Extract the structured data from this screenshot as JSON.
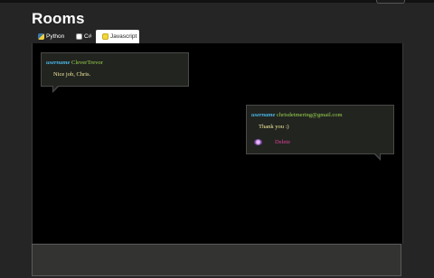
{
  "page": {
    "title": "Rooms"
  },
  "tabs": [
    {
      "label": "Python",
      "icon": "python-icon"
    },
    {
      "label": "C#",
      "icon": "csharp-icon"
    },
    {
      "label": "Javascript",
      "icon": "javascript-icon",
      "active": true
    }
  ],
  "messages": [
    {
      "username_label": "username",
      "username": "CleverTrevor",
      "text": "Nice job, Chris."
    },
    {
      "username_label": "username",
      "username": "chrisdetmering@gmail.com",
      "text": "Thank you :)",
      "edit_label": "",
      "delete_label": "Delete"
    }
  ],
  "colors": {
    "background": "#252525",
    "panel": "#000000",
    "username_label": "#49b6e6",
    "username": "#9bd64e",
    "message_text": "#f3ec9a",
    "delete": "#e0429a"
  }
}
